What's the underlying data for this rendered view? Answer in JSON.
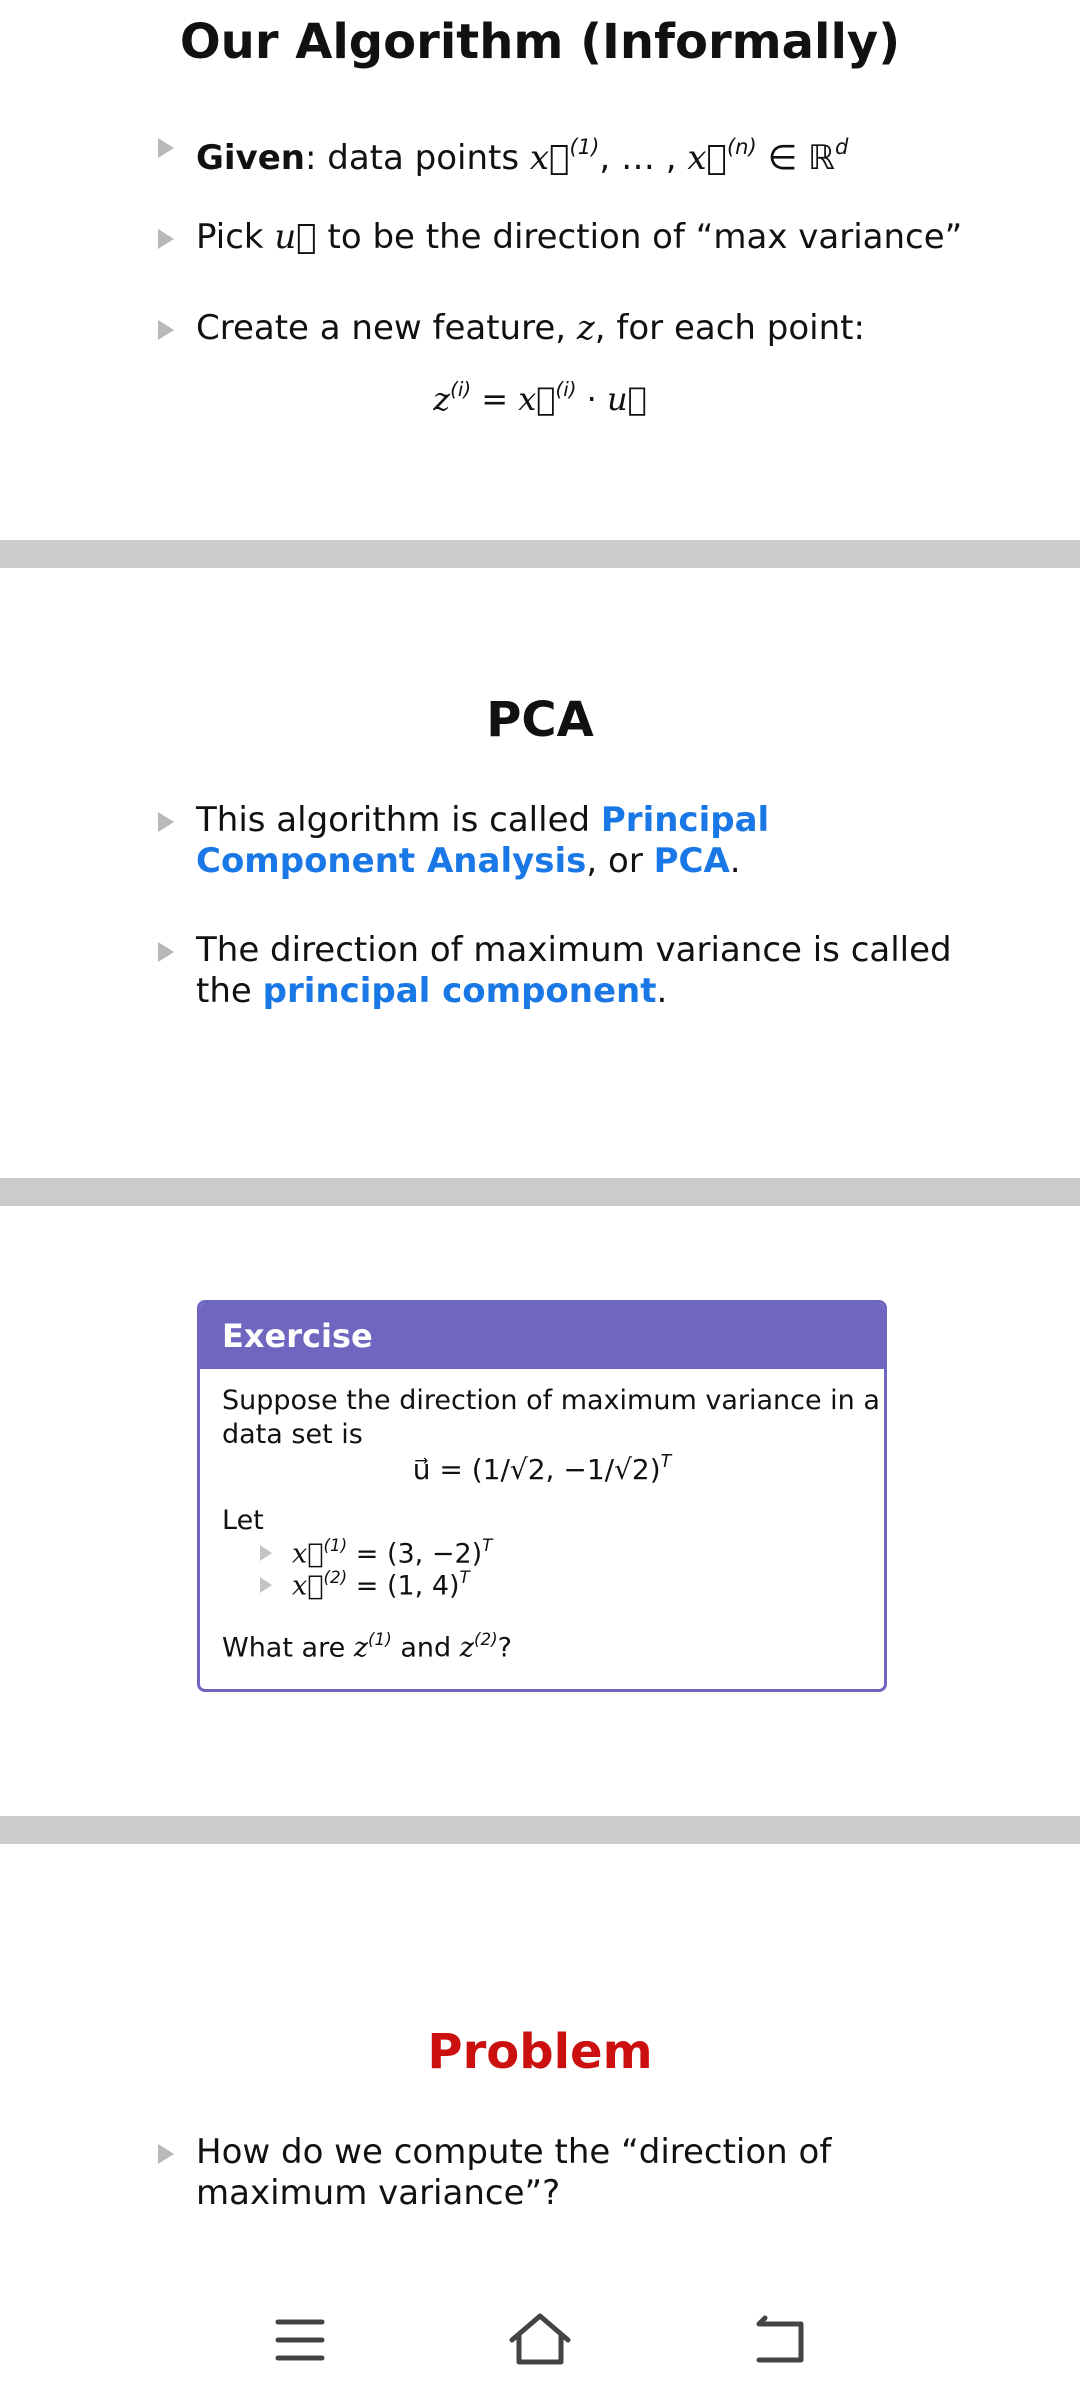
{
  "slide1": {
    "title": "Our Algorithm (Informally)",
    "bullet1": {
      "bold": "Given",
      "text": ": data points ",
      "x1": "x⃗",
      "x1_sup": "(1)",
      "mid": ", … , ",
      "xn": "x⃗",
      "xn_sup": "(n)",
      "in": " ∈ ℝ",
      "d": "d"
    },
    "bullet2": {
      "pre": "Pick ",
      "u": "u⃗",
      "post": " to be the direction of “max variance”"
    },
    "bullet3": {
      "pre": "Create a new feature, ",
      "z": "z",
      "post": ", for each point:"
    },
    "formula": {
      "z": "z",
      "z_sup": "(i)",
      "eq": " = ",
      "x": "x⃗",
      "x_sup": "(i)",
      "dot": " · ",
      "u": "u⃗"
    }
  },
  "slide2": {
    "title": "PCA",
    "bullet1": {
      "pre": "This algorithm is called ",
      "hl1": "Principal Component Analysis",
      "mid": ", or ",
      "hl2": "PCA",
      "post": "."
    },
    "bullet2": {
      "pre": "The direction of maximum variance is called the ",
      "hl": "principal component",
      "post": "."
    }
  },
  "slide3": {
    "exercise_title": "Exercise",
    "line1": "Suppose the direction of maximum variance in a",
    "line2": "data set is",
    "u_formula": "u⃗ = (1/√2, −1/√2)",
    "T": "T",
    "let": "Let",
    "x1_label": "x⃗",
    "x1_sup": "(1)",
    "x1_val": " = (3, −2)",
    "x2_label": "x⃗",
    "x2_sup": "(2)",
    "x2_val": " = (1, 4)",
    "question_pre": "What are ",
    "z": "z",
    "z1_sup": "(1)",
    "and": " and ",
    "z2_sup": "(2)",
    "question_post": "?"
  },
  "slide4": {
    "title": "Problem",
    "bullet1": "How do we compute the “direction of maximum variance”?"
  },
  "navbar": {
    "menu_icon": "menu-icon",
    "home_icon": "home-icon",
    "back_icon": "back-icon"
  },
  "colors": {
    "highlight": "#1a78e6",
    "exercise": "#6f67bf",
    "problem": "#cc1010",
    "separator": "#cbcbcb"
  }
}
